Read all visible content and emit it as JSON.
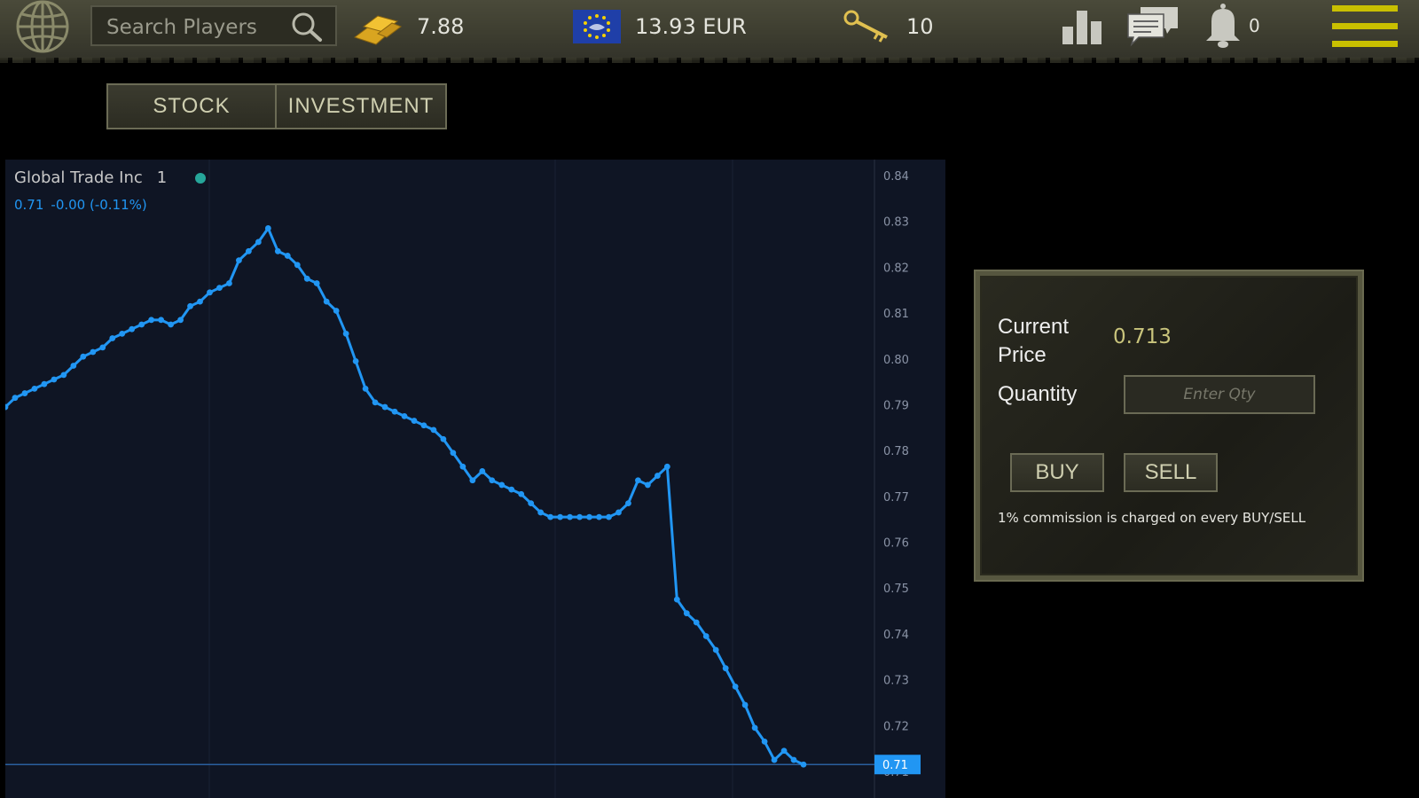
{
  "header": {
    "search_placeholder": "Search Players",
    "gold_value": "7.88",
    "currency_value": "13.93 EUR",
    "keys_value": "10",
    "notifications_count": "0"
  },
  "tabs": [
    {
      "label": "STOCK"
    },
    {
      "label": "INVESTMENT"
    }
  ],
  "chart": {
    "symbol": "Global Trade Inc",
    "interval": "1",
    "ohlc_value": "0.71",
    "ohlc_change": "-0.00 (-0.11%)"
  },
  "chart_data": {
    "type": "line",
    "ylim": [
      0.71,
      0.84
    ],
    "y_ticks": [
      "0.84",
      "0.83",
      "0.82",
      "0.81",
      "0.80",
      "0.79",
      "0.78",
      "0.77",
      "0.76",
      "0.75",
      "0.74",
      "0.73",
      "0.72",
      "0.71"
    ],
    "last_price_label": "0.71",
    "last_price": 0.7115,
    "series": [
      {
        "values": [
          0.7895,
          0.7915,
          0.7925,
          0.7935,
          0.7945,
          0.7955,
          0.7965,
          0.7985,
          0.8005,
          0.8015,
          0.8025,
          0.8045,
          0.8055,
          0.8065,
          0.8075,
          0.8085,
          0.8085,
          0.8075,
          0.8085,
          0.8115,
          0.8125,
          0.8145,
          0.8155,
          0.8165,
          0.8215,
          0.8235,
          0.8255,
          0.8285,
          0.8235,
          0.8225,
          0.8205,
          0.8175,
          0.8165,
          0.8125,
          0.8105,
          0.8055,
          0.7995,
          0.7935,
          0.7905,
          0.7895,
          0.7885,
          0.7875,
          0.7865,
          0.7855,
          0.7845,
          0.7825,
          0.7795,
          0.7765,
          0.7735,
          0.7755,
          0.7735,
          0.7725,
          0.7715,
          0.7705,
          0.7685,
          0.7665,
          0.7655,
          0.7655,
          0.7655,
          0.7655,
          0.7655,
          0.7655,
          0.7655,
          0.7665,
          0.7685,
          0.7735,
          0.7725,
          0.7745,
          0.7765,
          0.7475,
          0.7445,
          0.7425,
          0.7395,
          0.7365,
          0.7325,
          0.7285,
          0.7245,
          0.7195,
          0.7165,
          0.7125,
          0.7145,
          0.7125,
          0.7115
        ]
      }
    ]
  },
  "panel": {
    "current_price_label": "Current Price",
    "current_price_value": "0.713",
    "quantity_label": "Quantity",
    "quantity_placeholder": "Enter Qty",
    "buy_label": "BUY",
    "sell_label": "SELL",
    "commission_note": "1% commission is charged on every BUY/SELL"
  },
  "colors": {
    "line": "#2196f3",
    "chart_bg": "#0f1524",
    "accent_yellow": "#c9c000",
    "price_text": "#c9c47c"
  }
}
